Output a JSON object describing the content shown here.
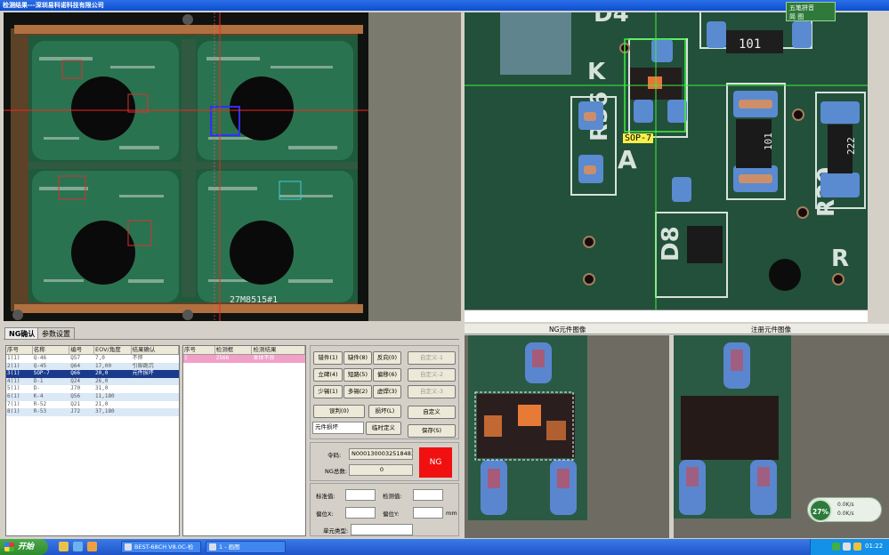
{
  "window": {
    "title": "检测结果---深圳易科诺科技有限公司"
  },
  "ime": {
    "name": "五笔拼音",
    "status": "简 图"
  },
  "board": {
    "label": "27M8515#1"
  },
  "zoom": {
    "component_label": "SOP-7"
  },
  "tabs": [
    {
      "label": "NG确认"
    },
    {
      "label": "参数设置"
    }
  ],
  "ng_table": {
    "headers": [
      "序号",
      "名称",
      "编号",
      "EOV/角度",
      "结果确认"
    ],
    "rows": [
      [
        "1(1)",
        "Q-46",
        "Q57",
        "7,0",
        "不焊"
      ],
      [
        "2(1)",
        "Q-45",
        "Q64",
        "17,00",
        "引脚跪沉"
      ],
      [
        "3(1)",
        "SOP-7",
        "Q66",
        "20,0",
        "元件损坏"
      ],
      [
        "4(1)",
        "D-1",
        "Q24",
        "26,0",
        ""
      ],
      [
        "5(1)",
        "D-",
        "J70",
        "31,0",
        ""
      ],
      [
        "6(1)",
        "K-4",
        "Q56",
        "11,180",
        ""
      ],
      [
        "7(1)",
        "R-52",
        "Q21",
        "21,0",
        ""
      ],
      [
        "8(1)",
        "R-53",
        "J72",
        "37,180",
        ""
      ]
    ]
  },
  "result_table": {
    "headers": [
      "序号",
      "检测框",
      "检测结果"
    ],
    "rows": [
      [
        "1",
        "2566",
        "本体不良"
      ]
    ]
  },
  "buttons": {
    "grid": [
      [
        "错件(1)",
        "缺件(8)",
        "反向(0)"
      ],
      [
        "立碑(4)",
        "短路(5)",
        "偏移(6)"
      ],
      [
        "少锡(1)",
        "多锡(2)",
        "虚焊(3)"
      ]
    ],
    "misjudge": "误判(0)",
    "damage": "损坏(L)",
    "temp_define": "临时定义",
    "custom_defs": [
      "自定义-1",
      "自定义-2",
      "自定义-3"
    ],
    "custom": "自定义",
    "save": "保存(S)"
  },
  "defect_input": "元件损坏",
  "info": {
    "order_label": "令码:",
    "order_value": "N0001300032518483",
    "ng_count_label": "NG总数:",
    "ng_count_value": "0",
    "ng_status": "NG",
    "std_label": "标准值:",
    "det_label": "检测值:",
    "offx_label": "偏位X:",
    "offy_label": "偏位Y:",
    "unit": "mm",
    "elem_type_label": "单元类型:"
  },
  "image_panels": {
    "ng_title": "NG元件图像",
    "std_title": "注册元件图像"
  },
  "speed": {
    "percent": "27%",
    "up": "0.0K/s",
    "down": "0.0K/s"
  },
  "taskbar": {
    "start": "开始",
    "tasks": [
      "BEST-68CH V8.0C-检",
      "1 - 画图"
    ],
    "clock": "01:22"
  }
}
